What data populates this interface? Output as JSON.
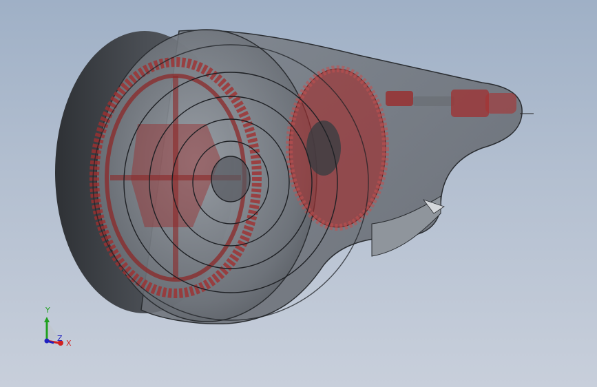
{
  "viewport": {
    "background_top": "#9fb0c6",
    "background_bottom": "#c8cfdb"
  },
  "model": {
    "shell_color": "#5a5f66",
    "gear_color": "#a03030"
  },
  "triad": {
    "x_label": "X",
    "y_label": "Y",
    "z_label": "Z",
    "x_color": "#d02020",
    "y_color": "#20a020",
    "z_color": "#2020c0"
  }
}
